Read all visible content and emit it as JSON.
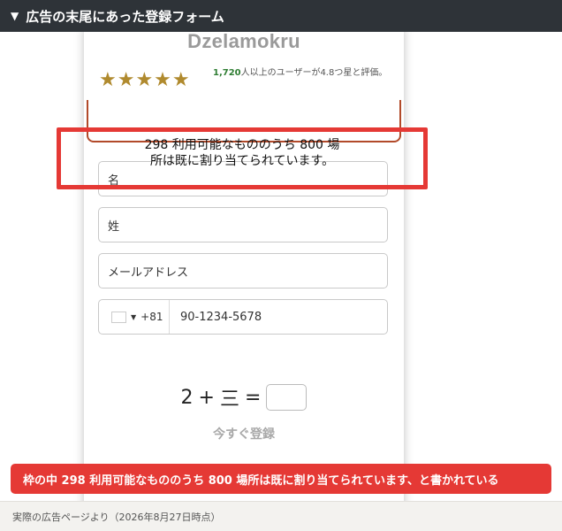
{
  "header": {
    "title": "広告の末尾にあった登録フォーム"
  },
  "form": {
    "brand": "Dzelamokru",
    "stars": "★★★★★",
    "rating_count": "1,720",
    "rating_text": "人以上のユーザーが4.8つ星と評価。",
    "availability_line1": "298 利用可能なもののうち 800 場",
    "availability_line2": "所は既に割り当てられています。",
    "fields": {
      "first_name_placeholder": "名",
      "last_name_placeholder": "姓",
      "email_placeholder": "メールアドレス",
      "country_code": "+81",
      "phone_placeholder": "90-1234-5678"
    },
    "captcha": {
      "num": "2",
      "plus": "+",
      "kanji": "三",
      "equals": "="
    },
    "submit_label": "今すぐ登録"
  },
  "caption": "枠の中 298 利用可能なもののうち 800 場所は既に割り当てられています、と書かれている",
  "footer": "実際の広告ページより（2026年8月27日時点）",
  "colors": {
    "header_bg": "#2e3338",
    "highlight": "#e53935",
    "star": "#b08a2e",
    "count": "#2e7d32"
  }
}
